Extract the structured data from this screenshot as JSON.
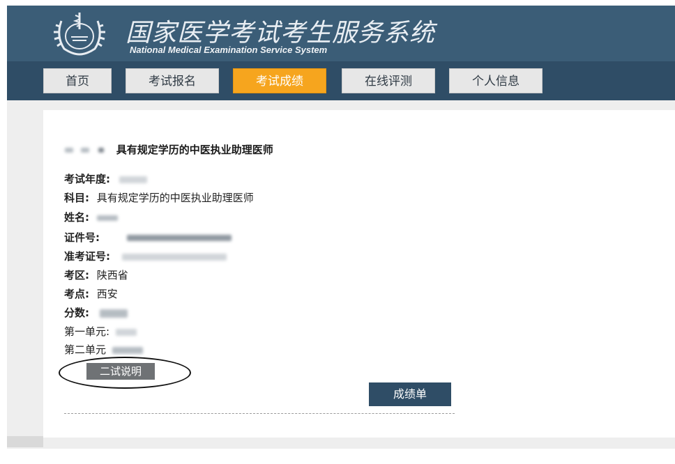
{
  "header": {
    "title_cn": "国家医学考试考生服务系统",
    "title_en": "National Medical Examination Service System"
  },
  "nav": {
    "items": [
      {
        "label": "首页",
        "active": false
      },
      {
        "label": "考试报名",
        "active": false
      },
      {
        "label": "考试成绩",
        "active": true
      },
      {
        "label": "在线评测",
        "active": false
      },
      {
        "label": "个人信息",
        "active": false
      }
    ]
  },
  "result": {
    "heading": "具有规定学历的中医执业助理医师",
    "fields": {
      "year_label": "考试年度:",
      "subject_label": "科目:",
      "subject_value": "具有规定学历的中医执业助理医师",
      "name_label": "姓名:",
      "id_label": "证件号:",
      "ticket_label": "准考证号:",
      "area_label": "考区:",
      "area_value": "陕西省",
      "site_label": "考点:",
      "site_value": "西安",
      "score_label": "分数:",
      "unit1_label": "第一单元:",
      "unit2_label": "第二单元"
    },
    "second_exam_button": "二试说明",
    "score_sheet_button": "成绩单"
  },
  "colors": {
    "header_bg": "#3b5d77",
    "nav_bg": "#2f4d66",
    "active_tab": "#f6a51e"
  }
}
